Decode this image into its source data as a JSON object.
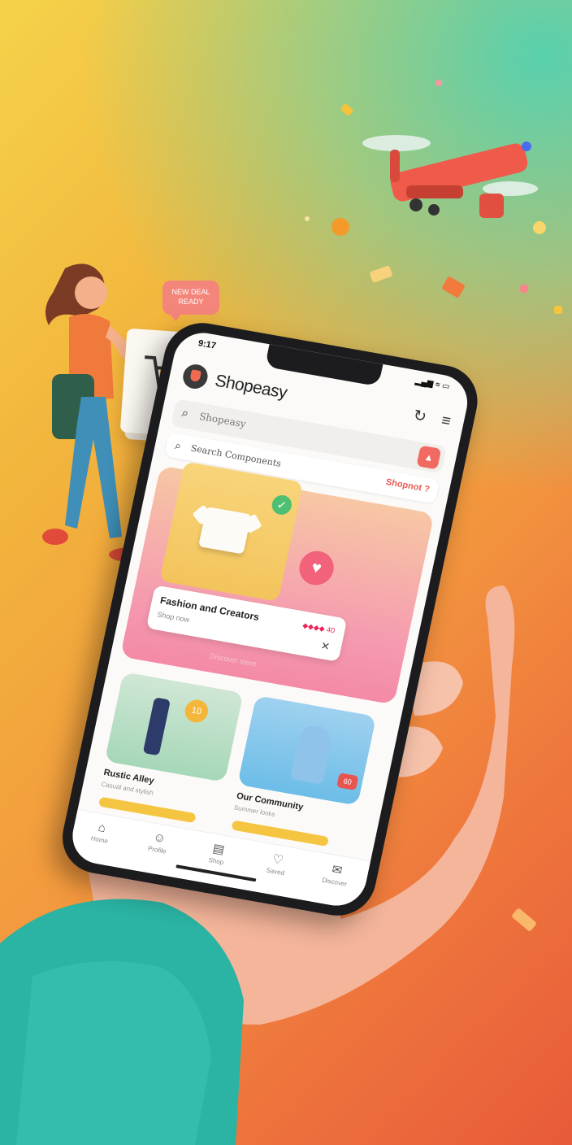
{
  "status": {
    "time": "9:17",
    "icons": "▂▄▆ ≈ ▭"
  },
  "app": {
    "title": "Shopeasy"
  },
  "search": {
    "placeholder": "Shopeasy",
    "button_icon": "filter-icon"
  },
  "subsearch": {
    "text": "Search Components",
    "link": "Shopnot ?"
  },
  "speech_bubble": {
    "text": "NEW DEAL READY"
  },
  "hero": {
    "card_title": "Fashion and Creators",
    "card_subtitle": "Shop now",
    "card_badge": "◆◆◆◆ 40",
    "footer": "Discover more"
  },
  "tiles": [
    {
      "label": "Rustic Alley",
      "subtitle": "Casual and stylish",
      "badge": "10"
    },
    {
      "label": "Our Community",
      "subtitle": "Summer looks",
      "badge": "60"
    }
  ],
  "tabs": [
    {
      "label": "Home",
      "icon": "⌂"
    },
    {
      "label": "Profile",
      "icon": "☺"
    },
    {
      "label": "Shop",
      "icon": "▤"
    },
    {
      "label": "Saved",
      "icon": "♡"
    },
    {
      "label": "Discover",
      "icon": "✉"
    }
  ],
  "colors": {
    "accent": "#f06a62",
    "brand_dark": "#1c1c1e",
    "teal": "#3dbfae"
  }
}
